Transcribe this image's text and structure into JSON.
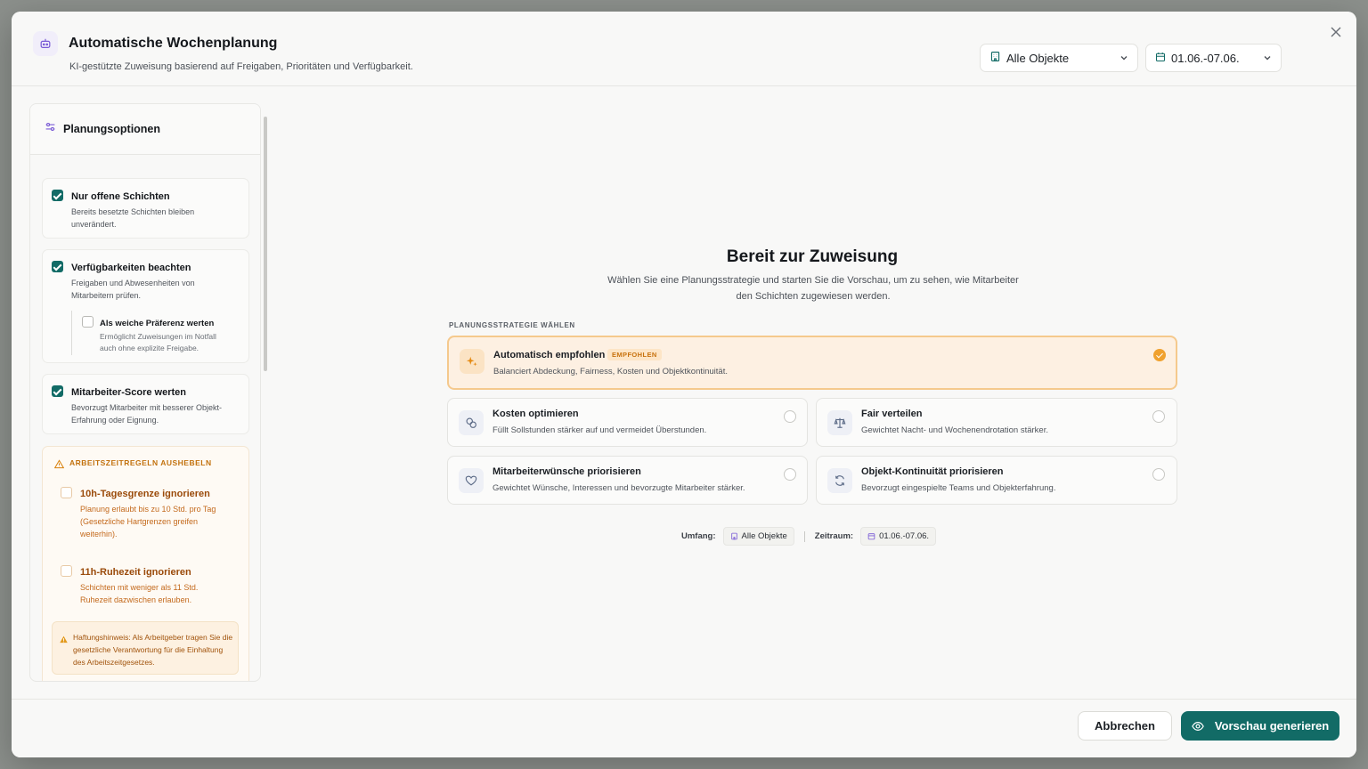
{
  "header": {
    "title": "Automatische Wochenplanung",
    "subtitle": "KI-gestützte Zuweisung basierend auf Freigaben, Prioritäten und Verfügbarkeit.",
    "objects_select": "Alle Objekte",
    "date_select": "01.06.-07.06."
  },
  "sidebar": {
    "title": "Planungsoptionen",
    "options": [
      {
        "title": "Nur offene Schichten",
        "desc": "Bereits besetzte Schichten bleiben unverändert.",
        "checked": true
      },
      {
        "title": "Verfügbarkeiten beachten",
        "desc": "Freigaben und Abwesenheiten von Mitarbeitern prüfen.",
        "checked": true
      },
      {
        "title": "Mitarbeiter-Score werten",
        "desc": "Bevorzugt Mitarbeiter mit besserer Objekt-Erfahrung oder Eignung.",
        "checked": true
      }
    ],
    "sub_option": {
      "title": "Als weiche Präferenz werten",
      "desc": "Ermöglicht Zuweisungen im Notfall auch ohne explizite Freigabe.",
      "checked": false
    },
    "warning": {
      "heading": "ARBEITSZEITREGELN AUSHEBELN",
      "items": [
        {
          "title": "10h-Tagesgrenze ignorieren",
          "desc": "Planung erlaubt bis zu 10 Std. pro Tag (Gesetzliche Hartgrenzen greifen weiterhin).",
          "checked": false
        },
        {
          "title": "11h-Ruhezeit ignorieren",
          "desc": "Schichten mit weniger als 11 Std. Ruhezeit dazwischen erlauben.",
          "checked": false
        }
      ],
      "liability": "Haftungshinweis: Als Arbeitgeber tragen Sie die gesetzliche Verantwortung für die Einhaltung des Arbeitszeitgesetzes."
    }
  },
  "main": {
    "title": "Bereit zur Zuweisung",
    "description": "Wählen Sie eine Planungsstrategie und starten Sie die Vorschau, um zu sehen, wie Mitarbeiter den Schichten zugewiesen werden.",
    "section_label": "PLANUNGSSTRATEGIE WÄHLEN",
    "strategies": [
      {
        "title": "Automatisch empfohlen",
        "badge": "EMPFOHLEN",
        "desc": "Balanciert Abdeckung, Fairness, Kosten und Objektkontinuität.",
        "selected": true,
        "icon": "sparkles-icon"
      },
      {
        "title": "Kosten optimieren",
        "desc": "Füllt Sollstunden stärker auf und vermeidet Überstunden.",
        "selected": false,
        "icon": "coins-icon"
      },
      {
        "title": "Fair verteilen",
        "desc": "Gewichtet Nacht- und Wochenendrotation stärker.",
        "selected": false,
        "icon": "scale-icon"
      },
      {
        "title": "Mitarbeiterwünsche priorisieren",
        "desc": "Gewichtet Wünsche, Interessen und bevorzugte Mitarbeiter stärker.",
        "selected": false,
        "icon": "heart-icon"
      },
      {
        "title": "Objekt-Kontinuität priorisieren",
        "desc": "Bevorzugt eingespielte Teams und Objekterfahrung.",
        "selected": false,
        "icon": "refresh-icon"
      }
    ],
    "scope_label": "Umfang:",
    "scope_value": "Alle Objekte",
    "period_label": "Zeitraum:",
    "period_value": "01.06.-07.06."
  },
  "footer": {
    "cancel": "Abbrechen",
    "generate": "Vorschau generieren"
  },
  "colors": {
    "primary": "#126b66",
    "accent_orange": "#f0a12e",
    "warning_text": "#c2710d"
  }
}
